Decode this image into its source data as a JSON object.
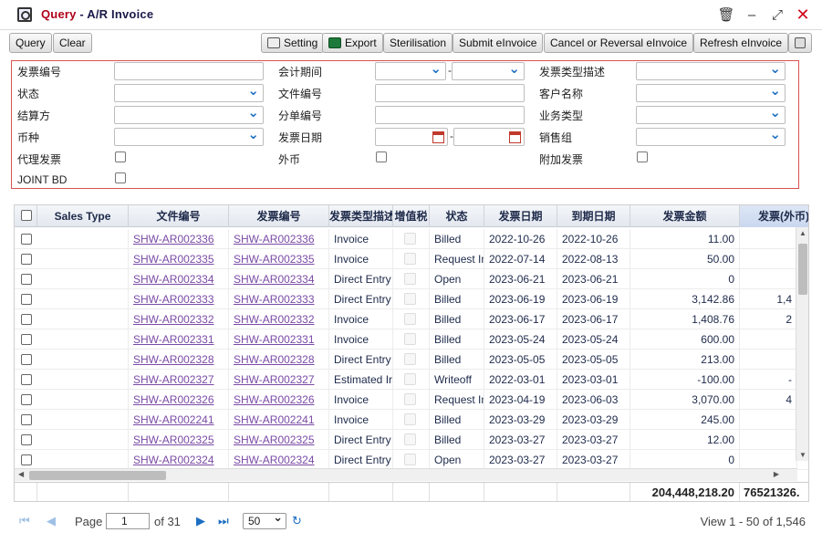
{
  "window": {
    "title_prefix": "Query",
    "title_sep": " - ",
    "title_name": "A/R Invoice",
    "icons": [
      "trash-icon",
      "minimize-icon",
      "maximize-icon",
      "close-icon"
    ]
  },
  "toolbar": {
    "query": "Query",
    "clear": "Clear",
    "setting": "Setting",
    "export": "Export",
    "sterilisation": "Sterilisation",
    "submit": "Submit eInvoice",
    "cancel": "Cancel or Reversal eInvoice",
    "refresh": "Refresh eInvoice"
  },
  "filter": {
    "invoice_no": "发票编号",
    "status": "状态",
    "settlement": "结算方",
    "currency": "币种",
    "agent_invoice": "代理发票",
    "joint_bd": "JOINT BD",
    "period": "会计期间",
    "file_no": "文件编号",
    "split_no": "分单编号",
    "invoice_date": "发票日期",
    "foreign_currency": "外币",
    "type_desc": "发票类型描述",
    "customer": "客户名称",
    "biz_type": "业务类型",
    "sales_group": "销售组",
    "extra_invoice": "附加发票",
    "dash": "-"
  },
  "grid": {
    "columns": [
      "Sales Type",
      "文件编号",
      "发票编号",
      "发票类型描述",
      "增值税",
      "状态",
      "发票日期",
      "到期日期",
      "发票金额",
      "发票(外币)"
    ],
    "rows": [
      {
        "file": "SHW-AR002336",
        "inv": "SHW-AR002336",
        "type": "Invoice",
        "status": "Billed",
        "date": "2022-10-26",
        "due": "2022-10-26",
        "amount": "11.00",
        "fx": ""
      },
      {
        "file": "SHW-AR002335",
        "inv": "SHW-AR002335",
        "type": "Invoice",
        "status": "Request In",
        "date": "2022-07-14",
        "due": "2022-08-13",
        "amount": "50.00",
        "fx": ""
      },
      {
        "file": "SHW-AR002334",
        "inv": "SHW-AR002334",
        "type": "Direct Entry",
        "status": "Open",
        "date": "2023-06-21",
        "due": "2023-06-21",
        "amount": "0",
        "fx": ""
      },
      {
        "file": "SHW-AR002333",
        "inv": "SHW-AR002333",
        "type": "Direct Entry",
        "status": "Billed",
        "date": "2023-06-19",
        "due": "2023-06-19",
        "amount": "3,142.86",
        "fx": "1,4"
      },
      {
        "file": "SHW-AR002332",
        "inv": "SHW-AR002332",
        "type": "Invoice",
        "status": "Billed",
        "date": "2023-06-17",
        "due": "2023-06-17",
        "amount": "1,408.76",
        "fx": "2"
      },
      {
        "file": "SHW-AR002331",
        "inv": "SHW-AR002331",
        "type": "Invoice",
        "status": "Billed",
        "date": "2023-05-24",
        "due": "2023-05-24",
        "amount": "600.00",
        "fx": ""
      },
      {
        "file": "SHW-AR002328",
        "inv": "SHW-AR002328",
        "type": "Direct Entry",
        "status": "Billed",
        "date": "2023-05-05",
        "due": "2023-05-05",
        "amount": "213.00",
        "fx": ""
      },
      {
        "file": "SHW-AR002327",
        "inv": "SHW-AR002327",
        "type": "Estimated Ir",
        "status": "Writeoff",
        "date": "2022-03-01",
        "due": "2023-03-01",
        "amount": "-100.00",
        "fx": "-"
      },
      {
        "file": "SHW-AR002326",
        "inv": "SHW-AR002326",
        "type": "Invoice",
        "status": "Request In",
        "date": "2023-04-19",
        "due": "2023-06-03",
        "amount": "3,070.00",
        "fx": "4"
      },
      {
        "file": "SHW-AR002241",
        "inv": "SHW-AR002241",
        "type": "Invoice",
        "status": "Billed",
        "date": "2023-03-29",
        "due": "2023-03-29",
        "amount": "245.00",
        "fx": ""
      },
      {
        "file": "SHW-AR002325",
        "inv": "SHW-AR002325",
        "type": "Direct Entry",
        "status": "Billed",
        "date": "2023-03-27",
        "due": "2023-03-27",
        "amount": "12.00",
        "fx": ""
      },
      {
        "file": "SHW-AR002324",
        "inv": "SHW-AR002324",
        "type": "Direct Entry",
        "status": "Open",
        "date": "2023-03-27",
        "due": "2023-03-27",
        "amount": "0",
        "fx": ""
      }
    ],
    "total_amount": "204,448,218.20",
    "total_fx": "76521326."
  },
  "pager": {
    "page_label": "Page",
    "page_value": "1",
    "of_label": "of 31",
    "page_size": "50",
    "view": "View 1 - 50 of 1,546"
  },
  "colors": {
    "accent": "#b0001a",
    "link": "#7a4aa5",
    "filter_border": "#d9534f"
  }
}
